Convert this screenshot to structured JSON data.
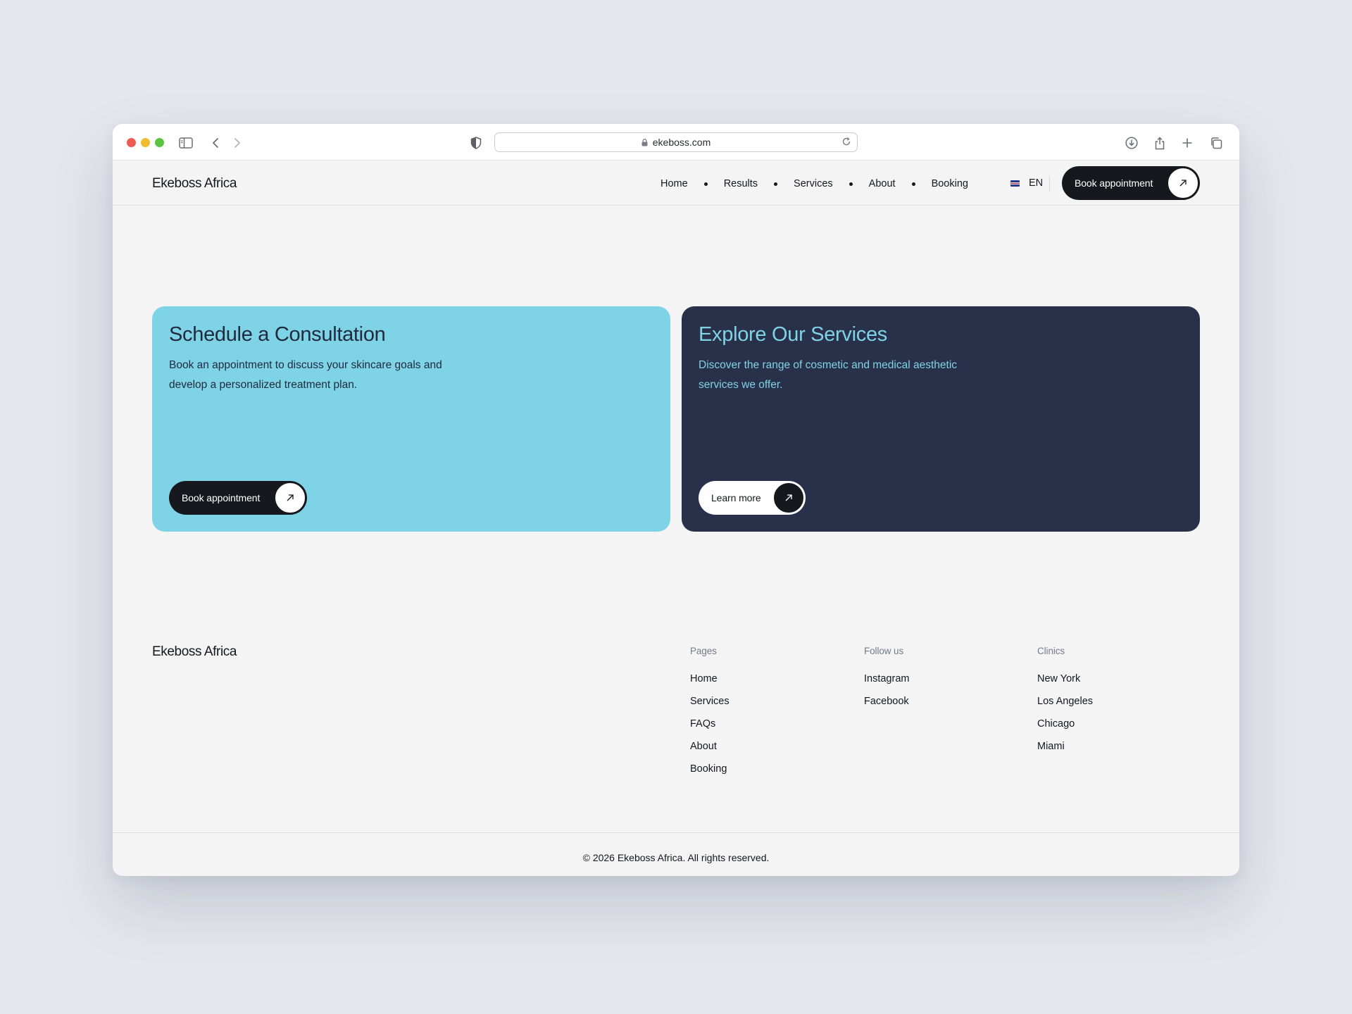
{
  "browser": {
    "url": "ekeboss.com"
  },
  "nav": {
    "brand": "Ekeboss Africa",
    "links": [
      "Home",
      "Results",
      "Services",
      "About",
      "Booking"
    ],
    "language": "EN",
    "cta_label": "Book appointment"
  },
  "cards": [
    {
      "title": "Schedule a Consultation",
      "text": "Book an appointment to discuss your skincare goals and develop a personalized treatment plan.",
      "button_label": "Book appointment",
      "background": "#7fd3e6"
    },
    {
      "title": "Explore Our Services",
      "text": "Discover the range of cosmetic and medical aesthetic services we offer.",
      "button_label": "Learn more",
      "background": "#29304a"
    }
  ],
  "footer": {
    "brand": "Ekeboss Africa",
    "columns": [
      {
        "heading": "Pages",
        "links": [
          "Home",
          "Services",
          "FAQs",
          "About",
          "Booking"
        ]
      },
      {
        "heading": "Follow us",
        "links": [
          "Instagram",
          "Facebook"
        ]
      },
      {
        "heading": "Clinics",
        "links": [
          "New York",
          "Los Angeles",
          "Chicago",
          "Miami"
        ]
      }
    ],
    "copyright": "© 2026 Ekeboss Africa. All rights reserved."
  },
  "icons": {
    "arrow": "arrow-up-right-icon",
    "flag": "uk-flag-icon"
  },
  "colors": {
    "accent_cyan": "#7fd3e6",
    "navy": "#29304a",
    "dark": "#16181d"
  }
}
